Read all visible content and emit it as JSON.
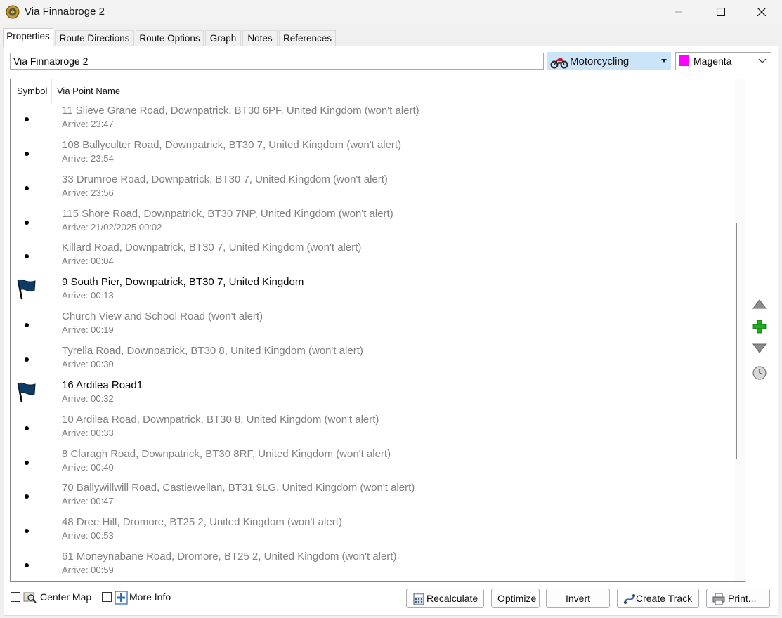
{
  "window": {
    "title": "Via Finnabroge 2"
  },
  "tabs": [
    {
      "label": "Properties",
      "active": true
    },
    {
      "label": "Route Directions"
    },
    {
      "label": "Route Options"
    },
    {
      "label": "Graph"
    },
    {
      "label": "Notes"
    },
    {
      "label": "References"
    }
  ],
  "route": {
    "name": "Via Finnabroge 2",
    "mode": "Motorcycling",
    "mode_icon": "motorcycle-icon",
    "color_name": "Magenta",
    "color_hex": "#ff00ff"
  },
  "list": {
    "columns": [
      "Symbol",
      "Via Point Name"
    ],
    "rows": [
      {
        "symbol": "bullet",
        "name": "11 Slieve Grane Road, Downpatrick, BT30 6PF, United Kingdom (won't alert)",
        "arrive": "Arrive: 23:47"
      },
      {
        "symbol": "bullet",
        "name": "108 Ballyculter Road, Downpatrick, BT30 7, United Kingdom (won't alert)",
        "arrive": "Arrive: 23:54"
      },
      {
        "symbol": "bullet",
        "name": "33 Drumroe Road, Downpatrick, BT30 7, United Kingdom (won't alert)",
        "arrive": "Arrive: 23:56"
      },
      {
        "symbol": "bullet",
        "name": "115 Shore Road, Downpatrick, BT30 7NP, United Kingdom (won't alert)",
        "arrive": "Arrive: 21/02/2025 00:02"
      },
      {
        "symbol": "bullet",
        "name": "Killard Road, Downpatrick, BT30 7, United Kingdom (won't alert)",
        "arrive": "Arrive: 00:04"
      },
      {
        "symbol": "flag",
        "name": "9 South Pier, Downpatrick, BT30 7, United Kingdom",
        "arrive": "Arrive: 00:13"
      },
      {
        "symbol": "bullet",
        "name": "Church View and School Road (won't alert)",
        "arrive": "Arrive: 00:19"
      },
      {
        "symbol": "bullet",
        "name": "Tyrella Road, Downpatrick, BT30 8, United Kingdom (won't alert)",
        "arrive": "Arrive: 00:30"
      },
      {
        "symbol": "flag",
        "name": "16 Ardilea Road1",
        "arrive": "Arrive: 00:32"
      },
      {
        "symbol": "bullet",
        "name": "10 Ardilea Road, Downpatrick, BT30 8, United Kingdom (won't alert)",
        "arrive": "Arrive: 00:33"
      },
      {
        "symbol": "bullet",
        "name": "8 Claragh Road, Downpatrick, BT30 8RF, United Kingdom (won't alert)",
        "arrive": "Arrive: 00:40"
      },
      {
        "symbol": "bullet",
        "name": "70 Ballywillwill Road, Castlewellan, BT31 9LG, United Kingdom (won't alert)",
        "arrive": "Arrive: 00:47"
      },
      {
        "symbol": "bullet",
        "name": "48 Dree Hill, Dromore, BT25 2, United Kingdom (won't alert)",
        "arrive": "Arrive: 00:53"
      },
      {
        "symbol": "bullet",
        "name": "61 Moneynabane Road, Dromore, BT25 2, United Kingdom (won't alert)",
        "arrive": "Arrive: 00:59"
      }
    ]
  },
  "side_buttons": [
    "move-up-icon",
    "add-icon",
    "move-down-icon",
    "clock-icon"
  ],
  "footer": {
    "center_map_label": "Center Map",
    "center_map_checked": false,
    "more_info_label": "More Info",
    "more_info_checked": false,
    "recalculate_label": "Recalculate",
    "optimize_label": "Optimize",
    "invert_label": "Invert",
    "create_track_label": "Create Track",
    "print_label": "Print..."
  }
}
